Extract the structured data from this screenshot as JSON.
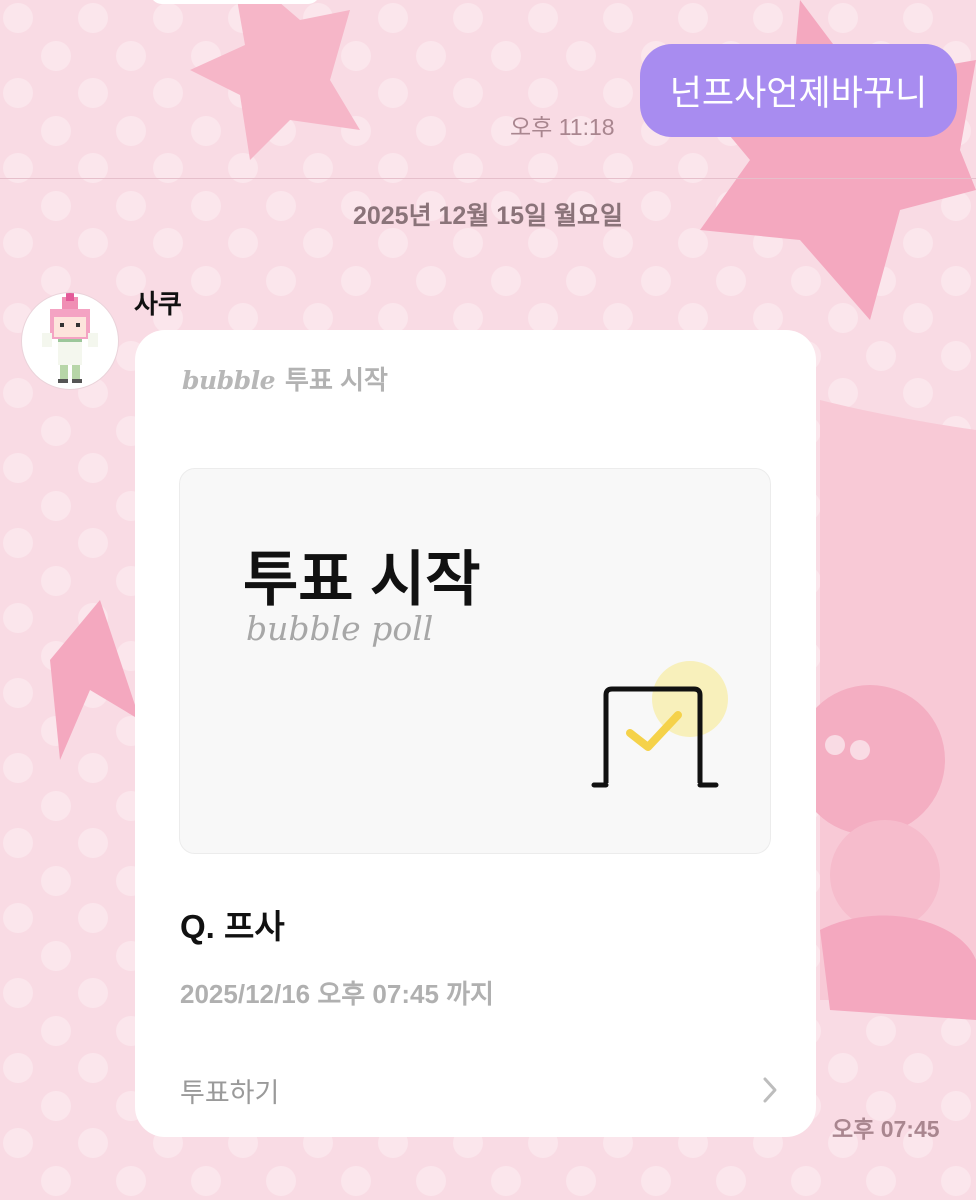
{
  "chat": {
    "prev_message": {
      "text": "넌프사언제바꾸니",
      "time": "오후 11:18"
    },
    "date_divider": "2025년 12월 15일 월요일",
    "sender": {
      "name": "사쿠"
    },
    "poll_card": {
      "brand": "bubble",
      "header": "투표 시작",
      "title": "투표 시작",
      "subtitle": "bubble poll",
      "question": "Q. 프사",
      "deadline": "2025/12/16 오후 07:45 까지",
      "action_label": "투표하기",
      "time": "오후 07:45"
    }
  },
  "colors": {
    "background": "#f9dbe4",
    "sent_bubble": "#a88cf0",
    "check_accent": "#f5d24a"
  },
  "icons": {
    "ballot": "ballot-box-check-icon",
    "chevron": "chevron-right-icon"
  }
}
